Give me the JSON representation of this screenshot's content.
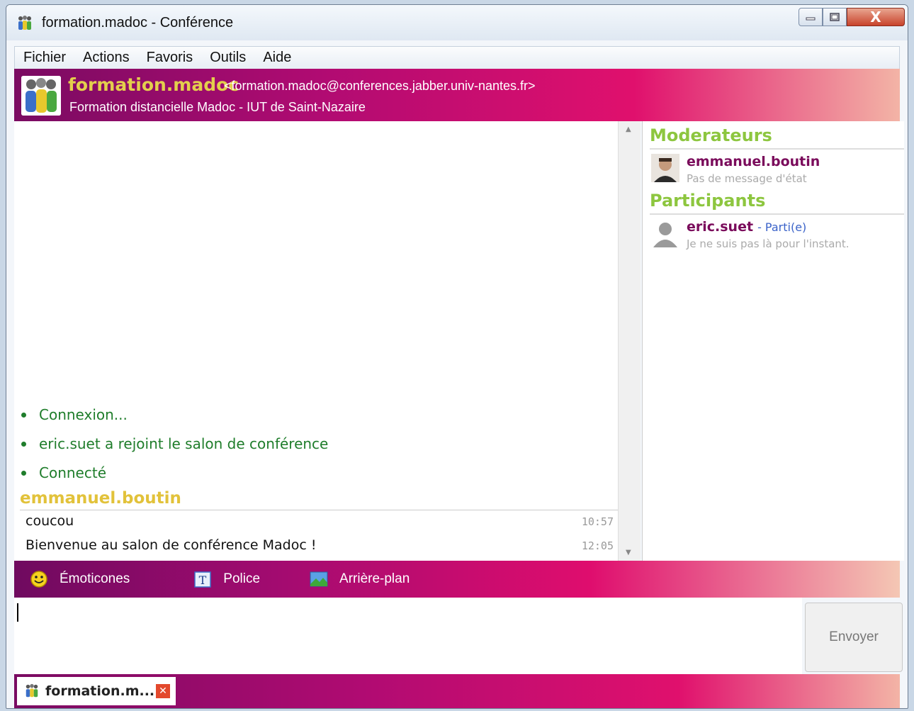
{
  "window": {
    "title": "formation.madoc - Conférence",
    "controls": {
      "minimize": "minimize",
      "maximize": "maximize",
      "close": "X"
    }
  },
  "menu": {
    "items": [
      "Fichier",
      "Actions",
      "Favoris",
      "Outils",
      "Aide"
    ]
  },
  "room": {
    "name": "formation.madoc",
    "jid": "<formation.madoc@conferences.jabber.univ-nantes.fr>",
    "description": "Formation distancielle Madoc - IUT de Saint-Nazaire"
  },
  "chat": {
    "system_messages": [
      "Connexion...",
      "eric.suet a rejoint le salon de conférence",
      "Connecté"
    ],
    "sender": "emmanuel.boutin",
    "messages": [
      {
        "text": "coucou",
        "time": "10:57"
      },
      {
        "text": "Bienvenue au salon de conférence Madoc !",
        "time": "12:05"
      }
    ]
  },
  "roster": {
    "moderators_heading": "Moderateurs",
    "participants_heading": "Participants",
    "moderators": [
      {
        "name": "emmanuel.boutin",
        "status": "Pas de message d'état"
      }
    ],
    "participants": [
      {
        "name": "eric.suet",
        "state": "- Parti(e)",
        "status": "Je ne suis pas là pour l'instant."
      }
    ]
  },
  "format_bar": {
    "emoticons": "Émoticones",
    "font": "Police",
    "background": "Arrière-plan"
  },
  "input": {
    "send_label": "Envoyer"
  },
  "tabs": [
    {
      "label": "formation.m..."
    }
  ],
  "colors": {
    "header_gradient_start": "#7a0b62",
    "header_gradient_end": "#f3b4a6",
    "room_name": "#e3cf4c",
    "system_message": "#1f7d2b",
    "sender_name": "#e2c23a",
    "roster_heading": "#8dc63f",
    "roster_name": "#7a0b5b"
  }
}
